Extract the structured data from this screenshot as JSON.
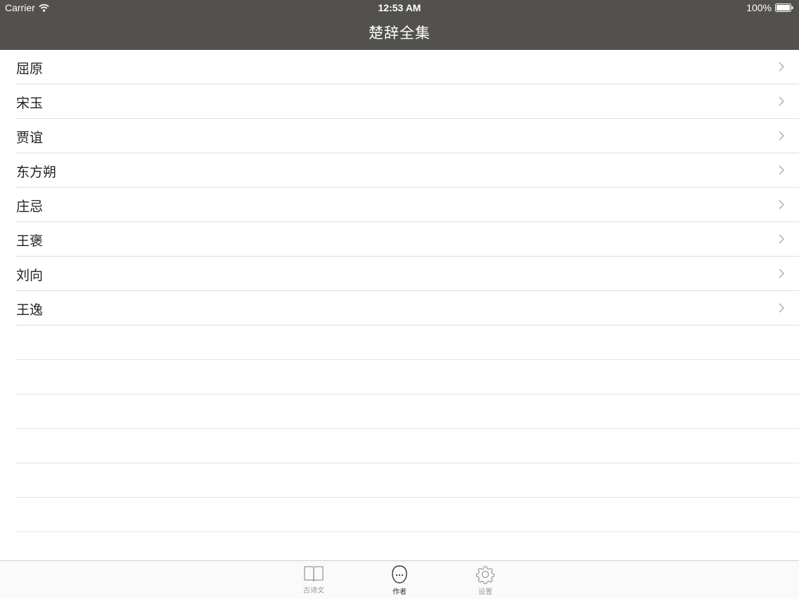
{
  "status": {
    "carrier": "Carrier",
    "time": "12:53 AM",
    "battery": "100%"
  },
  "nav": {
    "title": "楚辞全集"
  },
  "authors": [
    {
      "name": "屈原"
    },
    {
      "name": "宋玉"
    },
    {
      "name": "贾谊"
    },
    {
      "name": "东方朔"
    },
    {
      "name": "庄忌"
    },
    {
      "name": "王褒"
    },
    {
      "name": "刘向"
    },
    {
      "name": "王逸"
    }
  ],
  "tabs": [
    {
      "label": "古诗文",
      "icon": "book-icon",
      "active": false
    },
    {
      "label": "作者",
      "icon": "person-icon",
      "active": true
    },
    {
      "label": "设置",
      "icon": "gear-icon",
      "active": false
    }
  ],
  "colors": {
    "navbar": "#53514d",
    "separator": "#dedede",
    "tab_active": "#333333",
    "tab_inactive": "#9a9a9a"
  }
}
